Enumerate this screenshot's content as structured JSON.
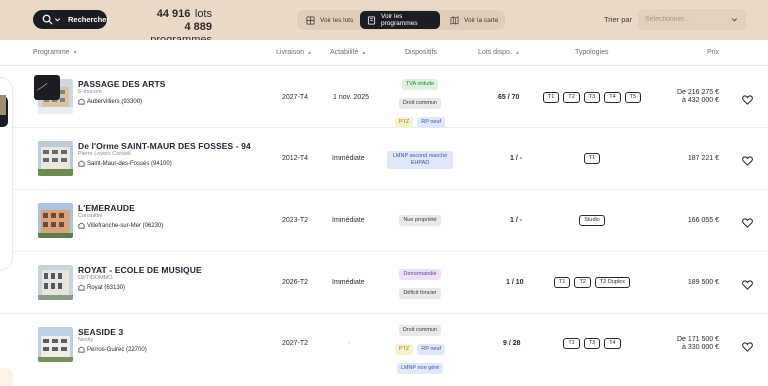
{
  "topbar": {
    "search_label": "Rechercher",
    "lots_count": "44 916",
    "lots_unit": "lots",
    "programmes_count": "4 889",
    "programmes_unit": "programmes",
    "views": [
      {
        "label": "Voir les lots",
        "icon": "grid-icon",
        "active": false
      },
      {
        "label": "Voir les programmes",
        "icon": "building-icon",
        "active": true
      },
      {
        "label": "Voir la carte",
        "icon": "map-icon",
        "active": false
      }
    ],
    "sort_label": "Trier par",
    "sort_placeholder": "Sélectionner..."
  },
  "columns": {
    "programme": "Programme",
    "livraison": "Livraison",
    "actabilite": "Actabilité",
    "dispositifs": "Dispositifs",
    "lots": "Lots dispo.",
    "typologies": "Typologies",
    "prix": "Prix"
  },
  "rows": [
    {
      "title": "PASSAGE DES ARTS",
      "developer": "E-mocom",
      "location": "Aubervilliers (93300)",
      "livraison": "2027-T4",
      "actabilite": "1 nov. 2025",
      "dispositifs": [
        {
          "label": "TVA réduite",
          "color": "green"
        },
        {
          "label": "Droit commun",
          "color": "gray"
        },
        {
          "label": "PTZ",
          "color": "yellow"
        },
        {
          "label": "RP neuf",
          "color": "blue"
        }
      ],
      "lots": "65 / 70",
      "typologies": [
        "T1",
        "T2",
        "T3",
        "T4",
        "T5"
      ],
      "price_from": "De 216 275 €",
      "price_to": "à 432 000 €"
    },
    {
      "title": "De l'Orme SAINT-MAUR DES FOSSES - 94",
      "developer": "Pierre Loyers Conseil",
      "location": "Saint-Maur-des-Fossés (94100)",
      "livraison": "2012-T4",
      "actabilite": "Immédiate",
      "dispositifs": [
        {
          "label": "LMNP second marché",
          "label2": "EHPAD",
          "color": "blue"
        }
      ],
      "lots": "1 /",
      "lots_suffix": "-",
      "typologies": [
        "T1"
      ],
      "price_single": "187 221 €"
    },
    {
      "title": "L'EMERAUDE",
      "developer": "Consultim",
      "location": "Villefranche-sur-Mer (06230)",
      "livraison": "2023-T2",
      "actabilite": "Immédiate",
      "dispositifs": [
        {
          "label": "Nue propriété",
          "color": "gray"
        }
      ],
      "lots": "1 /",
      "lots_suffix": "-",
      "typologies": [
        "Studio"
      ],
      "price_single": "166 055 €"
    },
    {
      "title": "ROYAT - ECOLE DE MUSIQUE",
      "developer": "OPTIDOMMO",
      "location": "Royat (63130)",
      "livraison": "2026-T2",
      "actabilite": "Immédiate",
      "dispositifs": [
        {
          "label": "Denormandie",
          "color": "purple"
        },
        {
          "label": "Déficit foncier",
          "color": "gray"
        }
      ],
      "lots": "1 / 10",
      "typologies": [
        "T1",
        "T2",
        "T2 Duplex"
      ],
      "price_single": "189 500 €"
    },
    {
      "title": "SEASIDE 3",
      "developer": "Nexity",
      "location": "Perros-Guirec (22700)",
      "livraison": "2027-T2",
      "actabilite": "-",
      "dispositifs": [
        {
          "label": "Droit commun",
          "color": "gray"
        },
        {
          "label": "PTZ",
          "color": "yellow"
        },
        {
          "label": "RP neuf",
          "color": "blue"
        },
        {
          "label": "LMNP non géré",
          "color": "blue"
        }
      ],
      "lots": "9 / 28",
      "typologies": [
        "T1",
        "T3",
        "T4"
      ],
      "price_from": "De 171 500 €",
      "price_to": "à 330 000 €"
    }
  ],
  "colors": {
    "topbar_bg": "#ead9c7",
    "dark_button": "#1b1d22",
    "text": "#1f2430"
  }
}
